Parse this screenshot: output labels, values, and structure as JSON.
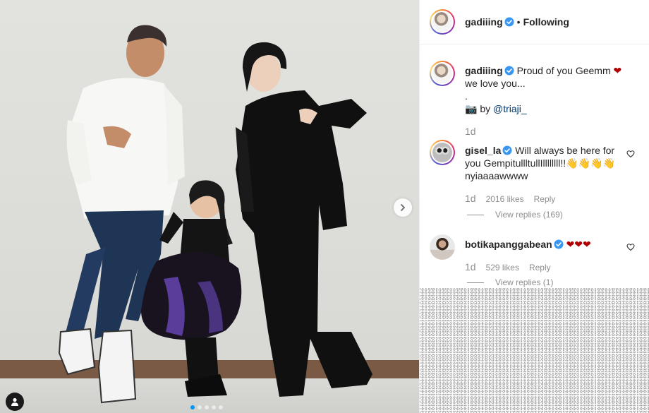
{
  "post": {
    "author": "gadiiing",
    "follow_separator": "•",
    "follow_status": "Following",
    "carousel": {
      "slide_count": 5,
      "active_slide": 1
    }
  },
  "caption": {
    "username": "gadiiing",
    "line1": "Proud of you Geemm",
    "heart": "❤",
    "line2": "we love you...",
    "line3": ".",
    "credit_prefix": "📷 by ",
    "credit_handle": "@triaji_",
    "time": "1d"
  },
  "comments": [
    {
      "username": "gisel_la",
      "text": "Will always be here for you GempitullltullIllllllll!!👋👋👋👋 nyiaaaawwww",
      "time": "1d",
      "likes": "2016 likes",
      "reply_label": "Reply",
      "view_replies": "View replies (169)"
    },
    {
      "username": "botikapanggabean",
      "text": "❤❤❤",
      "time": "1d",
      "likes": "529 likes",
      "reply_label": "Reply",
      "view_replies": "View replies (1)"
    }
  ],
  "colors": {
    "verified_badge": "#3897f0",
    "link": "#00376b",
    "heart": "#ed4956",
    "carousel_active_dot": "#0095f6"
  },
  "icons": [
    "verified-badge-icon",
    "chevron-right-icon",
    "user-tag-icon",
    "heart-outline-icon"
  ]
}
